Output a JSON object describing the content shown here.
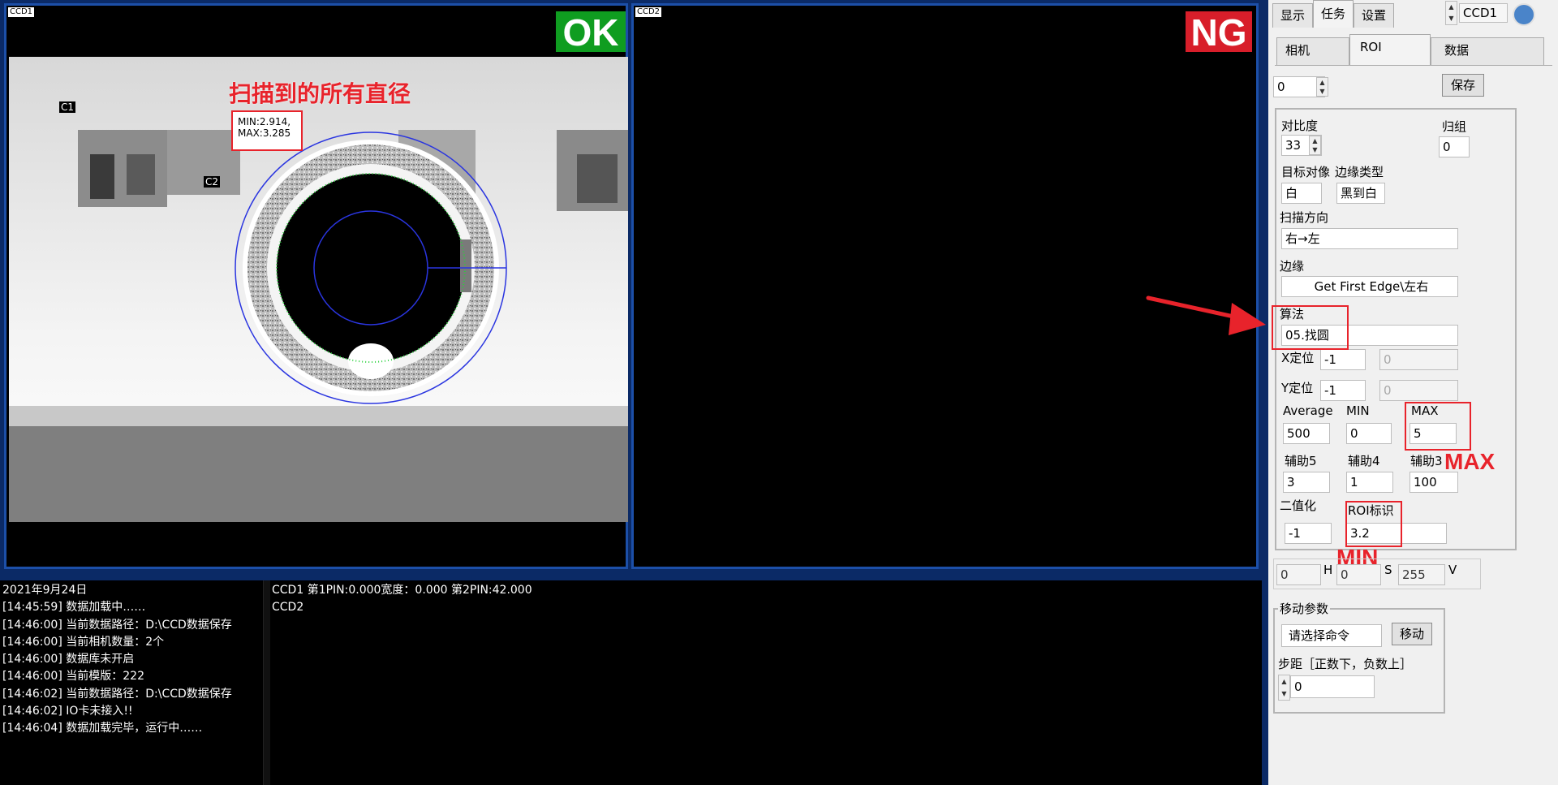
{
  "ccd1": {
    "tag": "CCD1",
    "status": "OK",
    "status_color": "#0f9d20",
    "c1_label": "C1",
    "c2_label": "C2",
    "annotation_title": "扫描到的所有直径",
    "min_text": "MIN:2.914,",
    "max_text": "MAX:3.285"
  },
  "ccd2": {
    "tag": "CCD2",
    "status": "NG",
    "status_color": "#d81e2a"
  },
  "log_left": [
    "2021年9月24日",
    "[14:45:59]  数据加载中……",
    "[14:46:00]  当前数据路径：D:\\CCD数据保存",
    "[14:46:00]  当前相机数量：2个",
    "[14:46:00]  数据库未开启",
    "[14:46:00]  当前模版：222",
    "[14:46:02]  当前数据路径：D:\\CCD数据保存",
    "[14:46:02]  IO卡未接入!!",
    "[14:46:04]  数据加载完毕，运行中……"
  ],
  "log_right": [
    "CCD1 第1PIN:0.000宽度：0.000  第2PIN:42.000",
    "CCD2"
  ],
  "panel": {
    "top_tabs": [
      "显示",
      "任务",
      "设置"
    ],
    "camera_select": "CCD1",
    "sub_tabs": [
      "相机",
      "ROI",
      "数据"
    ],
    "roi_index": "0",
    "save_label": "保存",
    "contrast_label": "对比度",
    "contrast_value": "33",
    "group_label": "归组",
    "group_value": "0",
    "target_label": "目标对像",
    "target_value": "白",
    "edge_type_label": "边缘类型",
    "edge_type_value": "黑到白",
    "scan_dir_label": "扫描方向",
    "scan_dir_value": "右→左",
    "edge_label": "边缘",
    "edge_value": "Get First Edge\\左右",
    "algo_label": "算法",
    "algo_value": "05.找圆",
    "x_label": "X定位",
    "x_value": "-1",
    "x_value2": "0",
    "y_label": "Y定位",
    "y_value": "-1",
    "y_value2": "0",
    "avg_label": "Average",
    "avg_value": "500",
    "min_label": "MIN",
    "min_value": "0",
    "max_label": "MAX",
    "max_value": "5",
    "aux5_label": "辅助5",
    "aux5_value": "3",
    "aux4_label": "辅助4",
    "aux4_value": "1",
    "aux3_label": "辅助3",
    "aux3_value": "100",
    "binary_label": "二值化",
    "binary_value": "-1",
    "roi_mark_label": "ROI标识",
    "roi_mark_value": "3.2",
    "h_value": "0",
    "h_label": "H",
    "s_value": "0",
    "s_label": "S",
    "v_value": "255",
    "v_label": "V",
    "move_group_label": "移动参数",
    "move_cmd": "请选择命令",
    "move_btn": "移动",
    "step_label": "步距［正数下，负数上］",
    "step_value": "0",
    "max_annotation": "MAX",
    "min_annotation": "MIN"
  }
}
